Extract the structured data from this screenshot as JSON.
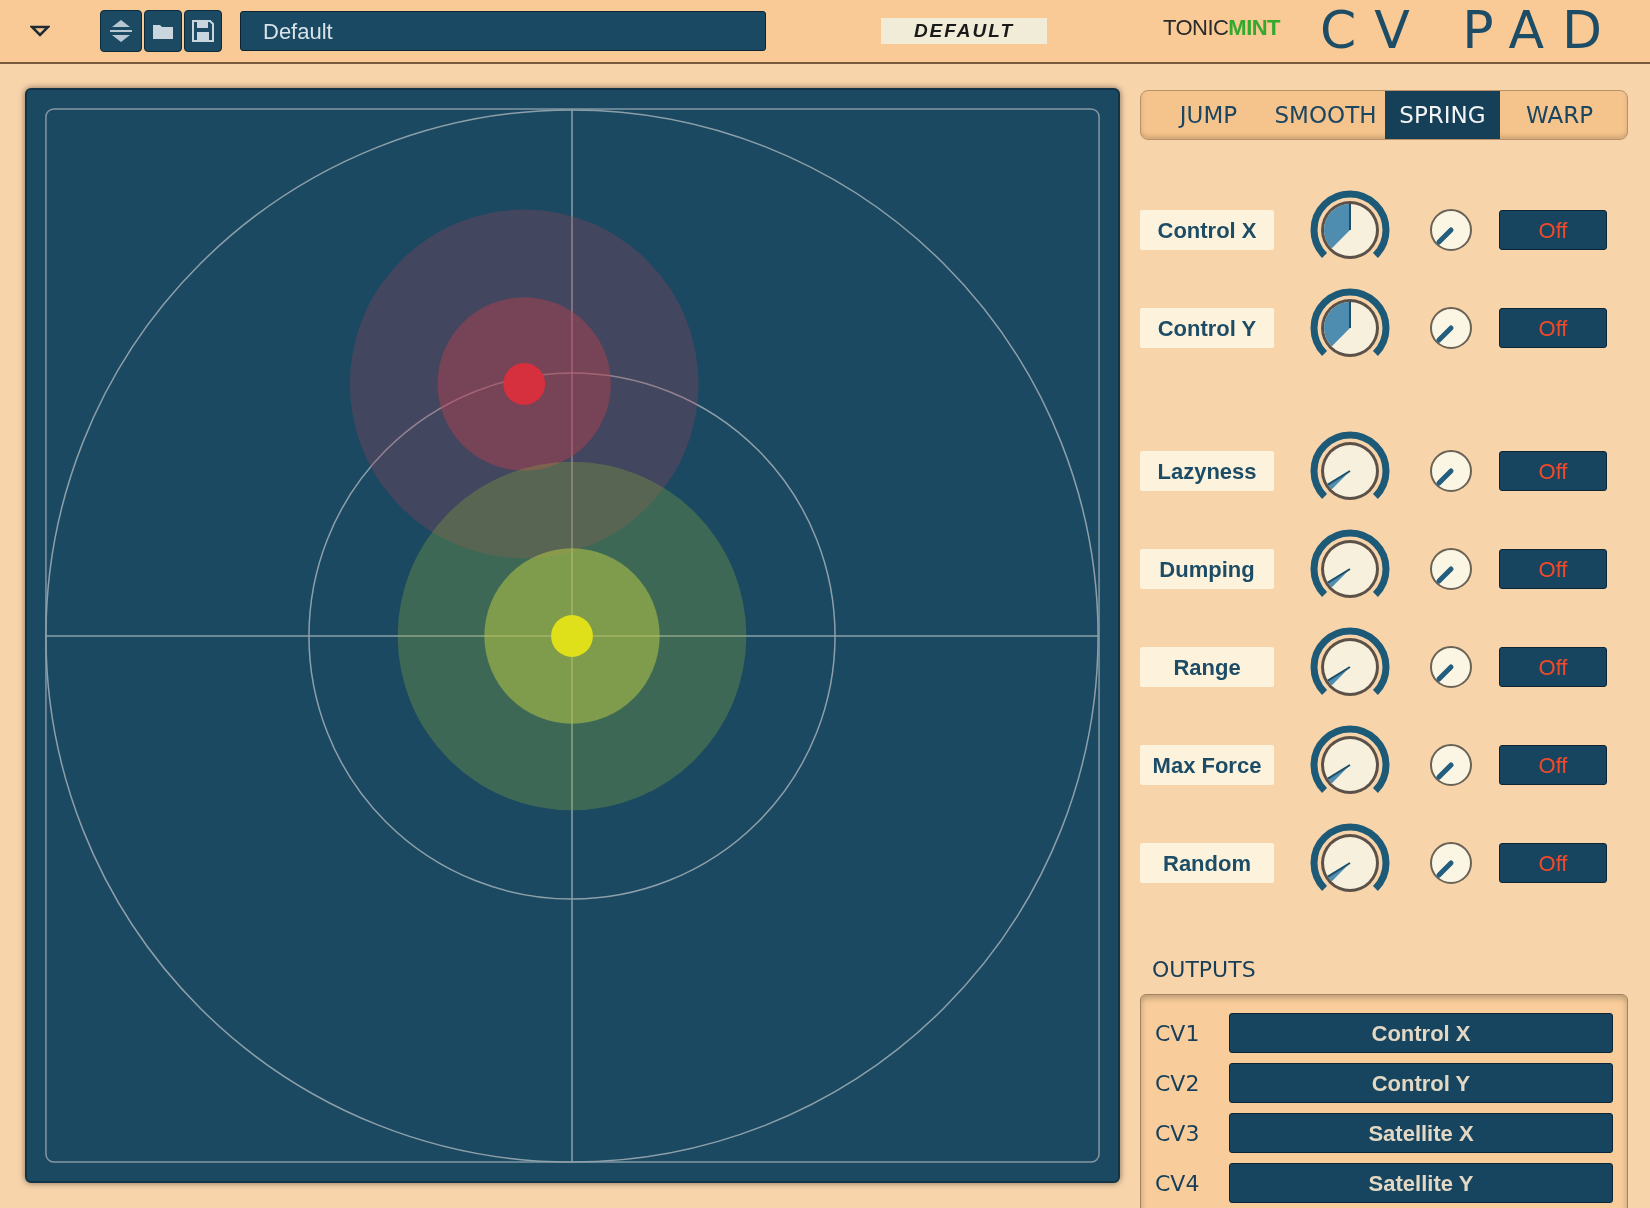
{
  "header": {
    "preset_name": "Default",
    "patch_label": "DEFAULT",
    "brand": {
      "part_1": "TONIC",
      "part_2": "MINT"
    },
    "title": "CV PAD"
  },
  "modes": [
    {
      "label": "JUMP",
      "selected": false
    },
    {
      "label": "SMOOTH",
      "selected": false
    },
    {
      "label": "SPRING",
      "selected": true
    },
    {
      "label": "WARP",
      "selected": false
    }
  ],
  "parameters": [
    {
      "label": "Control X",
      "kind": "bipolar",
      "button": "Off"
    },
    {
      "label": "Control Y",
      "kind": "bipolar",
      "button": "Off"
    },
    {
      "label": "Lazyness",
      "kind": "unipolar",
      "button": "Off"
    },
    {
      "label": "Dumping",
      "kind": "unipolar",
      "button": "Off"
    },
    {
      "label": "Range",
      "kind": "unipolar",
      "button": "Off"
    },
    {
      "label": "Max Force",
      "kind": "unipolar",
      "button": "Off"
    },
    {
      "label": "Random",
      "kind": "unipolar",
      "button": "Off"
    }
  ],
  "outputs": {
    "title": "OUTPUTS",
    "rows": [
      {
        "label": "CV1",
        "value": "Control X"
      },
      {
        "label": "CV2",
        "value": "Control Y"
      },
      {
        "label": "CV3",
        "value": "Satellite X"
      },
      {
        "label": "CV4",
        "value": "Satellite Y"
      }
    ]
  }
}
